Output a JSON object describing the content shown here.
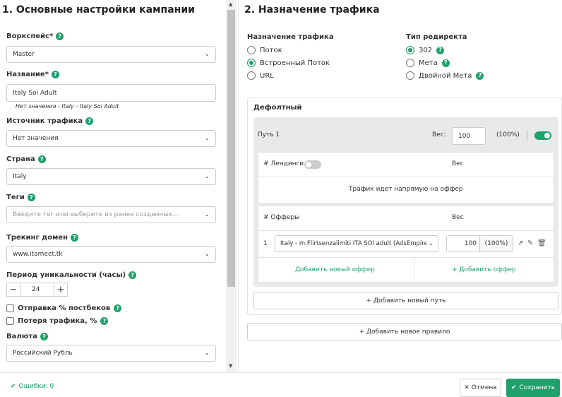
{
  "colors": {
    "accent": "#20a06a"
  },
  "left": {
    "title": "1. Основные настройки кампании",
    "workspace": {
      "label": "Воркспейс*",
      "value": "Master"
    },
    "name": {
      "label": "Название*",
      "value": "Italy Soi Adult",
      "hint": "Нет значения - Italy - Italy Soi Adult"
    },
    "source": {
      "label": "Источник трафика",
      "value": "Нет значения"
    },
    "country": {
      "label": "Страна",
      "value": "Italy"
    },
    "tags": {
      "label": "Теги",
      "placeholder": "Введите тег или выберите из ранее созданных..."
    },
    "domain": {
      "label": "Трекинг домен",
      "value": "www.itameet.tk"
    },
    "uniqueness": {
      "label": "Период уникальности (часы)",
      "value": "24",
      "minus": "−",
      "plus": "+"
    },
    "postbacks": {
      "label": "Отправка % постбеков",
      "checked": false
    },
    "loss": {
      "label": "Потеря трафика, %",
      "checked": false
    },
    "currency": {
      "label": "Валюта",
      "value": "Российский Рубль"
    }
  },
  "right": {
    "title": "2. Назначение трафика",
    "destination": {
      "label": "Назначение трафика",
      "options": [
        "Поток",
        "Встроенный Поток",
        "URL"
      ],
      "selected": "Встроенный Поток"
    },
    "redirect": {
      "label": "Тип редиректа",
      "options": [
        "302",
        "Мета",
        "Двойной Мета"
      ],
      "selected": "302"
    },
    "rule": {
      "title": "Дефолтный",
      "path": {
        "name": "Путь 1",
        "weight_label": "Вес:",
        "weight": "100",
        "percent": "(100%)",
        "enabled": true,
        "landings": {
          "header": "# Лендинги",
          "weight_header": "Вес",
          "toggle_on": false,
          "direct_text": "Трафик идет напрямую на оффер"
        },
        "offers": {
          "header": "# Офферы",
          "weight_header": "Вес",
          "rows": [
            {
              "index": "1",
              "name": "Italy - m.Flirtsenzalimiti ITA SOI adult (AdsEmpire)",
              "weight": "100",
              "percent": "(100%)"
            }
          ],
          "add_new": "Добавить новый оффер",
          "add": "+ Добавить оффер"
        }
      },
      "add_path": "+ Добавить новый путь"
    },
    "add_rule": "+ Добавить новое правило"
  },
  "footer": {
    "errors": "Ошибки: 0",
    "cancel": "Отмена",
    "save": "Сохранить"
  }
}
